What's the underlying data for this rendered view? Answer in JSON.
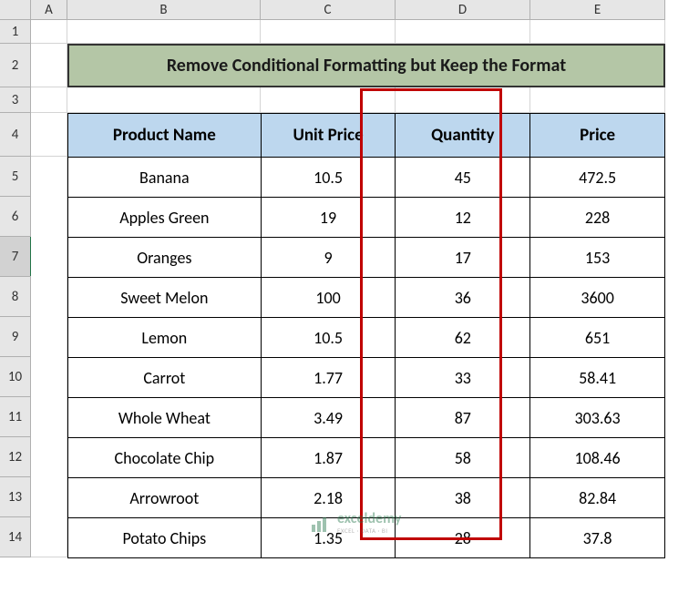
{
  "columns": [
    "A",
    "B",
    "C",
    "D",
    "E"
  ],
  "row_numbers": [
    "1",
    "2",
    "3",
    "4",
    "5",
    "6",
    "7",
    "8",
    "9",
    "10",
    "11",
    "12",
    "13",
    "14"
  ],
  "selected_row": "7",
  "title": "Remove Conditional Formatting but Keep the Format",
  "headers": {
    "product": "Product Name",
    "unit_price": "Unit Price",
    "quantity": "Quantity",
    "price": "Price"
  },
  "chart_data": {
    "type": "table",
    "title": "Remove Conditional Formatting but Keep the Format",
    "columns": [
      "Product Name",
      "Unit Price",
      "Quantity",
      "Price"
    ],
    "rows": [
      {
        "product": "Banana",
        "unit_price": "10.5",
        "quantity": "45",
        "price": "472.5"
      },
      {
        "product": "Apples Green",
        "unit_price": "19",
        "quantity": "12",
        "price": "228"
      },
      {
        "product": "Oranges",
        "unit_price": "9",
        "quantity": "17",
        "price": "153"
      },
      {
        "product": "Sweet Melon",
        "unit_price": "100",
        "quantity": "36",
        "price": "3600"
      },
      {
        "product": "Lemon",
        "unit_price": "10.5",
        "quantity": "62",
        "price": "651"
      },
      {
        "product": "Carrot",
        "unit_price": "1.77",
        "quantity": "33",
        "price": "58.41"
      },
      {
        "product": "Whole Wheat",
        "unit_price": "3.49",
        "quantity": "87",
        "price": "303.63"
      },
      {
        "product": "Chocolate Chip",
        "unit_price": "1.87",
        "quantity": "58",
        "price": "108.46"
      },
      {
        "product": "Arrowroot",
        "unit_price": "2.18",
        "quantity": "38",
        "price": "82.84"
      },
      {
        "product": "Potato Chips",
        "unit_price": "1.35",
        "quantity": "28",
        "price": "37.8"
      }
    ]
  },
  "watermark": {
    "brand": "exceldemy",
    "tagline": "EXCEL · DATA · BI"
  }
}
